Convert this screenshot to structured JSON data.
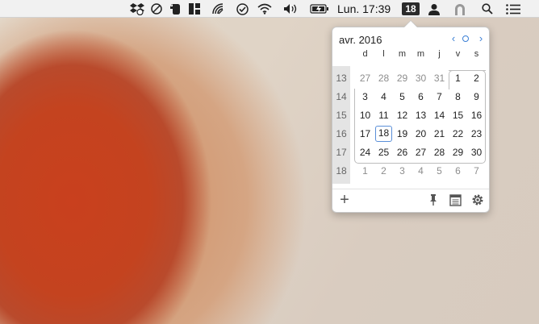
{
  "menubar": {
    "clock": "Lun. 17:39",
    "date_badge": "18",
    "icons": [
      "dropbox-sync-icon",
      "no-entry-icon",
      "evernote-icon",
      "grid-app-icon",
      "signal-icon",
      "checkmark-circle-icon",
      "wifi-icon",
      "volume-icon",
      "battery-charging-icon",
      "user-icon",
      "arch-app-icon",
      "search-icon",
      "list-menu-icon"
    ]
  },
  "calendar": {
    "month_title": "avr. 2016",
    "nav": {
      "prev": "‹",
      "next": "›"
    },
    "weekdays": [
      "d",
      "l",
      "m",
      "m",
      "j",
      "v",
      "s"
    ],
    "weeks": [
      {
        "num": "13",
        "days": [
          "27",
          "28",
          "29",
          "30",
          "31",
          "1",
          "2"
        ]
      },
      {
        "num": "14",
        "days": [
          "3",
          "4",
          "5",
          "6",
          "7",
          "8",
          "9"
        ]
      },
      {
        "num": "15",
        "days": [
          "10",
          "11",
          "12",
          "13",
          "14",
          "15",
          "16"
        ]
      },
      {
        "num": "16",
        "days": [
          "17",
          "18",
          "19",
          "20",
          "21",
          "22",
          "23"
        ]
      },
      {
        "num": "17",
        "days": [
          "24",
          "25",
          "26",
          "27",
          "28",
          "29",
          "30"
        ]
      },
      {
        "num": "18",
        "days": [
          "1",
          "2",
          "3",
          "4",
          "5",
          "6",
          "7"
        ]
      }
    ],
    "today": "18",
    "footer": {
      "add_label": "+"
    }
  },
  "colors": {
    "accent": "#3a7fd5",
    "today_ring": "#5a8fd8",
    "menubar_bg": "#f1f1f1"
  }
}
